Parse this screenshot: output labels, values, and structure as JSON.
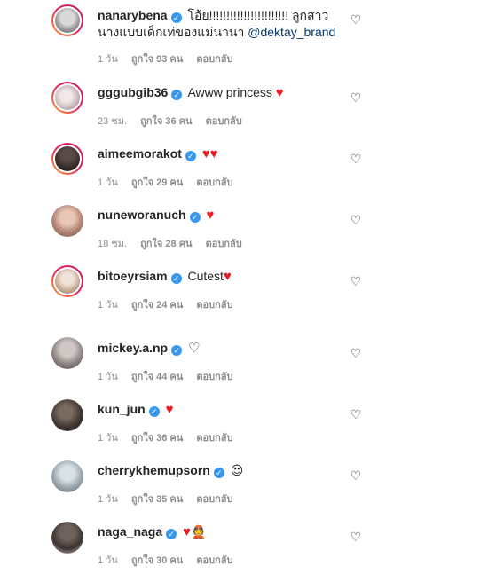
{
  "comments": [
    {
      "username": "nanarybena",
      "text_line1": "โอ้ย!!!!!!!!!!!!!!!!!!!!!!! ลูกสาว",
      "text_line2": "นางแบบเด็กเท่ของแม่นานา",
      "mention": "@dektay_brand",
      "time": "1 วัน",
      "likes": "ถูกใจ 93 คน",
      "reply": "ตอบกลับ"
    },
    {
      "username": "gggubgib36",
      "text": "Awww princess",
      "time": "23 ชม.",
      "likes": "ถูกใจ 36 คน",
      "reply": "ตอบกลับ"
    },
    {
      "username": "aimeemorakot",
      "text": "",
      "time": "1 วัน",
      "likes": "ถูกใจ 29 คน",
      "reply": "ตอบกลับ"
    },
    {
      "username": "nuneworanuch",
      "text": "",
      "time": "18 ชม.",
      "likes": "ถูกใจ 28 คน",
      "reply": "ตอบกลับ"
    },
    {
      "username": "bitoeyrsiam",
      "text": "Cutest",
      "time": "1 วัน",
      "likes": "ถูกใจ 24 คน",
      "reply": "ตอบกลับ"
    },
    {
      "username": "mickey.a.np",
      "text": "",
      "time": "1 วัน",
      "likes": "ถูกใจ 44 คน",
      "reply": "ตอบกลับ"
    },
    {
      "username": "kun_jun",
      "text": "",
      "time": "1 วัน",
      "likes": "ถูกใจ 36 คน",
      "reply": "ตอบกลับ"
    },
    {
      "username": "cherrykhemupsorn",
      "text": "",
      "time": "1 วัน",
      "likes": "ถูกใจ 35 คน",
      "reply": "ตอบกลับ"
    },
    {
      "username": "naga_naga",
      "text": "",
      "time": "1 วัน",
      "likes": "ถูกใจ 30 คน",
      "reply": "ตอบกลับ"
    }
  ],
  "icons": {
    "verified": "verified-badge-icon",
    "like": "heart-outline-icon"
  },
  "colors": {
    "verified_badge": "#3897f0",
    "heart": "#ed1c24",
    "mention": "#00376b",
    "meta": "#8e8e8e"
  }
}
